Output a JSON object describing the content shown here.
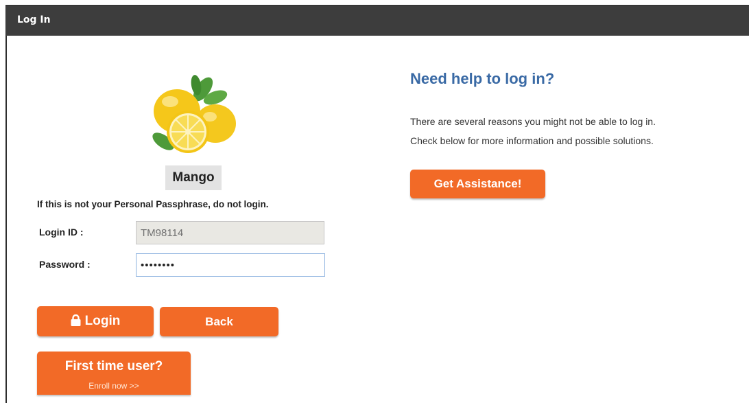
{
  "window": {
    "title": "Log In"
  },
  "passphrase": {
    "word": "Mango"
  },
  "warning": "If this is not your Personal Passphrase, do not login.",
  "form": {
    "login_id_label": "Login ID :",
    "login_id_value": "TM98114",
    "password_label": "Password :",
    "password_value": "••••••••"
  },
  "buttons": {
    "login": "Login",
    "back": "Back",
    "first_time": "First time user?",
    "enroll": "Enroll now >>"
  },
  "help": {
    "title": "Need help to log in?",
    "line1": "There are several reasons you might not be able to log in.",
    "line2": "Check below for more information and possible solutions.",
    "assist_button": "Get Assistance!"
  },
  "colors": {
    "accent": "#f26a27",
    "title_bar": "#3d3d3d",
    "help_title": "#3a6aa5"
  },
  "icons": {
    "login_button": "lock-icon",
    "passphrase_image": "lemon-image"
  }
}
